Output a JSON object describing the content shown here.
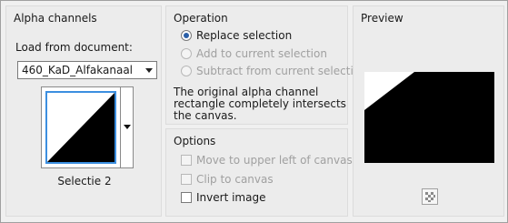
{
  "alpha": {
    "title": "Alpha channels",
    "load_label": "Load from document:",
    "document_value": "460_KaD_Alfakanaal",
    "selection_name": "Selectie 2"
  },
  "operation": {
    "title": "Operation",
    "options": [
      {
        "label": "Replace selection",
        "selected": true,
        "enabled": true
      },
      {
        "label": "Add to current selection",
        "selected": false,
        "enabled": false
      },
      {
        "label": "Subtract from current selection",
        "selected": false,
        "enabled": false
      }
    ],
    "note": "The original alpha channel rectangle completely intersects the canvas."
  },
  "options": {
    "title": "Options",
    "items": [
      {
        "label": "Move to upper left of canvas",
        "checked": false,
        "enabled": false
      },
      {
        "label": "Clip to canvas",
        "checked": false,
        "enabled": false
      },
      {
        "label": "Invert image",
        "checked": false,
        "enabled": true
      }
    ]
  },
  "preview": {
    "title": "Preview",
    "toggle_icon": "checkerboard-icon"
  }
}
